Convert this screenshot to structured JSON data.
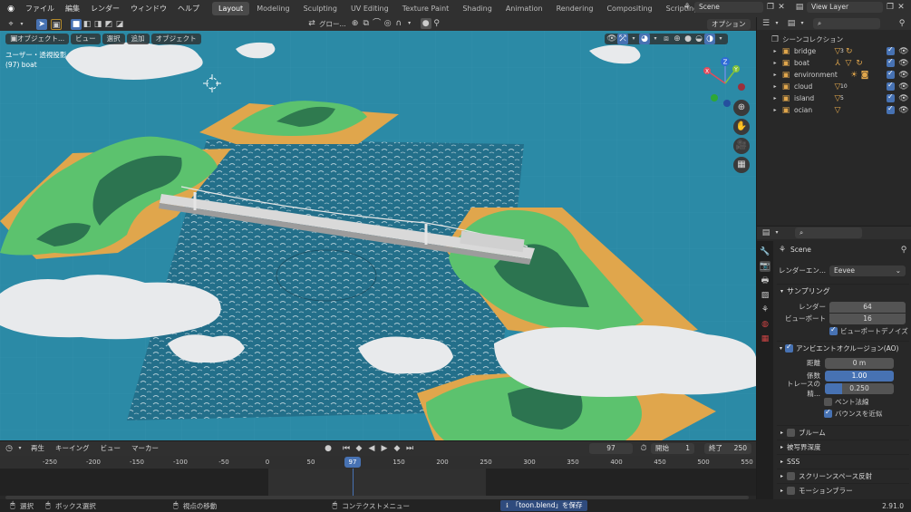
{
  "topbar": {
    "menus": [
      "ファイル",
      "編集",
      "レンダー",
      "ウィンドウ",
      "ヘルプ"
    ],
    "workspaces": [
      "Layout",
      "Modeling",
      "Sculpting",
      "UV Editing",
      "Texture Paint",
      "Shading",
      "Animation",
      "Rendering",
      "Compositing",
      "Scripting"
    ],
    "active_workspace": "Layout",
    "add_tab": "+",
    "scene": "Scene",
    "view_layer": "View Layer"
  },
  "tool_header": {
    "transform_orientation": "グロー...",
    "options": "オプション"
  },
  "viewport_header": {
    "mode": "オブジェクト...",
    "menus": [
      "ビュー",
      "選択",
      "追加",
      "オブジェクト"
    ]
  },
  "viewport": {
    "view_name": "ユーザー・透視投影",
    "object_info": "(97) boat",
    "gizmo": {
      "x": "X",
      "y": "Y",
      "z": "Z"
    }
  },
  "outliner": {
    "search_placeholder": "",
    "root": "シーンコレクション",
    "items": [
      {
        "name": "bridge",
        "badge": "3"
      },
      {
        "name": "boat",
        "badge": ""
      },
      {
        "name": "environment",
        "badge": ""
      },
      {
        "name": "cloud",
        "badge": "10"
      },
      {
        "name": "island",
        "badge": "5"
      },
      {
        "name": "ocian",
        "badge": ""
      }
    ]
  },
  "properties": {
    "scene_name": "Scene",
    "render_engine_label": "レンダーエン...",
    "render_engine_value": "Eevee",
    "sampling": {
      "title": "サンプリング",
      "render_label": "レンダー",
      "render_value": "64",
      "viewport_label": "ビューポート",
      "viewport_value": "16",
      "denoise_label": "ビューポートデノイズ"
    },
    "ao": {
      "title": "アンビエントオクルージョン(AO)",
      "distance_label": "距離",
      "distance_value": "0 m",
      "factor_label": "係数",
      "factor_value": "1.00",
      "trace_label": "トレースの精...",
      "trace_value": "0.250",
      "bent_normals": "ベント法線",
      "bounce": "バウンスを近似"
    },
    "sections": [
      "ブルーム",
      "被写界深度",
      "SSS",
      "スクリーンスペース反射",
      "モーションブラー"
    ]
  },
  "timeline": {
    "menus": [
      "再生",
      "キーイング",
      "ビュー",
      "マーカー"
    ],
    "current_frame": "97",
    "start_label": "開始",
    "start_value": "1",
    "end_label": "終了",
    "end_value": "250",
    "ruler": [
      "-250",
      "-200",
      "-150",
      "-100",
      "-50",
      "0",
      "50",
      "97",
      "150",
      "200",
      "250",
      "300",
      "350",
      "400",
      "450",
      "500",
      "550"
    ]
  },
  "statusbar": {
    "select": "選択",
    "box_select": "ボックス選択",
    "move_view": "視点の移動",
    "context_menu": "コンテクストメニュー",
    "notification": "「toon.blend」を保存",
    "version": "2.91.0"
  },
  "colors": {
    "accent": "#4772b3",
    "ocean": "#2b8aa6",
    "land_green": "#5cc26e",
    "sand": "#e0a64c"
  }
}
